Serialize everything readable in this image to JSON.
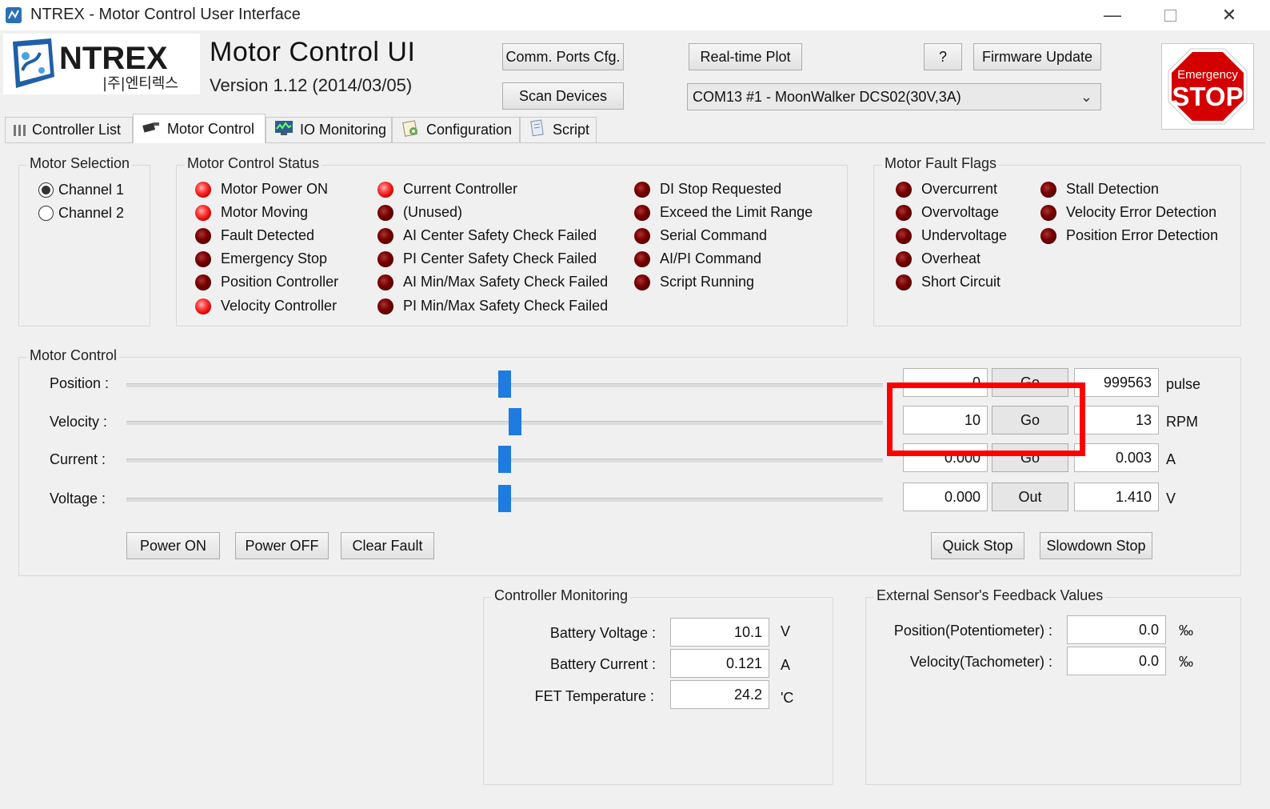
{
  "window": {
    "title": "NTREX - Motor Control User Interface",
    "icon": "ntrex-app-icon",
    "controls": [
      "minimize-icon",
      "maximize-icon",
      "close-icon"
    ]
  },
  "header": {
    "logo_brand": "NTREX",
    "logo_sub": "|주|엔티렉스",
    "title": "Motor Control UI",
    "version": "Version 1.12 (2014/03/05)",
    "buttons": {
      "comm_ports": "Comm. Ports Cfg.",
      "scan_devices": "Scan Devices",
      "realtime_plot": "Real-time Plot",
      "help": "?",
      "firmware_update": "Firmware Update"
    },
    "device_select": "COM13 #1 - MoonWalker DCS02(30V,3A)",
    "emergency_stop": {
      "top": "Emergency",
      "bottom": "STOP"
    }
  },
  "tabs": [
    {
      "label": "Controller List",
      "icon": "list-icon",
      "active": false
    },
    {
      "label": "Motor Control",
      "icon": "motor-icon",
      "active": true
    },
    {
      "label": "IO Monitoring",
      "icon": "monitor-icon",
      "active": false
    },
    {
      "label": "Configuration",
      "icon": "config-icon",
      "active": false
    },
    {
      "label": "Script",
      "icon": "script-icon",
      "active": false
    }
  ],
  "motor_selection": {
    "title": "Motor Selection",
    "options": [
      {
        "label": "Channel 1",
        "selected": true
      },
      {
        "label": "Channel 2",
        "selected": false
      }
    ]
  },
  "motor_status": {
    "title": "Motor Control Status",
    "col1": [
      {
        "label": "Motor Power ON",
        "on": true
      },
      {
        "label": "Motor Moving",
        "on": true
      },
      {
        "label": "Fault Detected",
        "on": false
      },
      {
        "label": "Emergency Stop",
        "on": false
      },
      {
        "label": "Position Controller",
        "on": false
      },
      {
        "label": "Velocity Controller",
        "on": true
      }
    ],
    "col2": [
      {
        "label": "Current Controller",
        "on": true
      },
      {
        "label": "(Unused)",
        "on": false
      },
      {
        "label": "AI Center Safety Check Failed",
        "on": false
      },
      {
        "label": "PI Center Safety Check Failed",
        "on": false
      },
      {
        "label": "AI Min/Max Safety Check Failed",
        "on": false
      },
      {
        "label": "PI Min/Max Safety Check Failed",
        "on": false
      }
    ],
    "col3": [
      {
        "label": "DI Stop Requested",
        "on": false
      },
      {
        "label": "Exceed the Limit Range",
        "on": false
      },
      {
        "label": "Serial Command",
        "on": false
      },
      {
        "label": "AI/PI Command",
        "on": false
      },
      {
        "label": "Script Running",
        "on": false
      }
    ]
  },
  "fault_flags": {
    "title": "Motor Fault Flags",
    "col1": [
      {
        "label": "Overcurrent",
        "on": false
      },
      {
        "label": "Overvoltage",
        "on": false
      },
      {
        "label": "Undervoltage",
        "on": false
      },
      {
        "label": "Overheat",
        "on": false
      },
      {
        "label": "Short Circuit",
        "on": false
      }
    ],
    "col2": [
      {
        "label": "Stall Detection",
        "on": false
      },
      {
        "label": "Velocity Error Detection",
        "on": false
      },
      {
        "label": "Position Error Detection",
        "on": false
      }
    ]
  },
  "motor_control": {
    "title": "Motor Control",
    "rows": [
      {
        "label": "Position :",
        "slider": 0.5,
        "input": "0",
        "action": "Go",
        "value": "999563",
        "unit": "pulse"
      },
      {
        "label": "Velocity :",
        "slider": 0.514,
        "input": "10",
        "action": "Go",
        "value": "13",
        "unit": "RPM"
      },
      {
        "label": "Current :",
        "slider": 0.5,
        "input": "0.000",
        "action": "Go",
        "value": "0.003",
        "unit": "A"
      },
      {
        "label": "Voltage :",
        "slider": 0.5,
        "input": "0.000",
        "action": "Out",
        "value": "1.410",
        "unit": "V"
      }
    ],
    "buttons": {
      "power_on": "Power ON",
      "power_off": "Power OFF",
      "clear_fault": "Clear Fault",
      "quick_stop": "Quick Stop",
      "slowdown_stop": "Slowdown Stop"
    }
  },
  "controller_monitoring": {
    "title": "Controller Monitoring",
    "rows": [
      {
        "label": "Battery Voltage :",
        "value": "10.1",
        "unit": "V"
      },
      {
        "label": "Battery Current :",
        "value": "0.121",
        "unit": "A"
      },
      {
        "label": "FET Temperature :",
        "value": "24.2",
        "unit": "'C"
      }
    ]
  },
  "external_sensor": {
    "title": "External Sensor's Feedback Values",
    "rows": [
      {
        "label": "Position(Potentiometer) :",
        "value": "0.0",
        "unit": "‰"
      },
      {
        "label": "Velocity(Tachometer) :",
        "value": "0.0",
        "unit": "‰"
      }
    ]
  },
  "colors": {
    "led_on": "#ff3b3b",
    "led_off": "#7a0000",
    "slider_thumb": "#1e7be0",
    "highlight": "#ff0000",
    "estop": "#d40000"
  }
}
